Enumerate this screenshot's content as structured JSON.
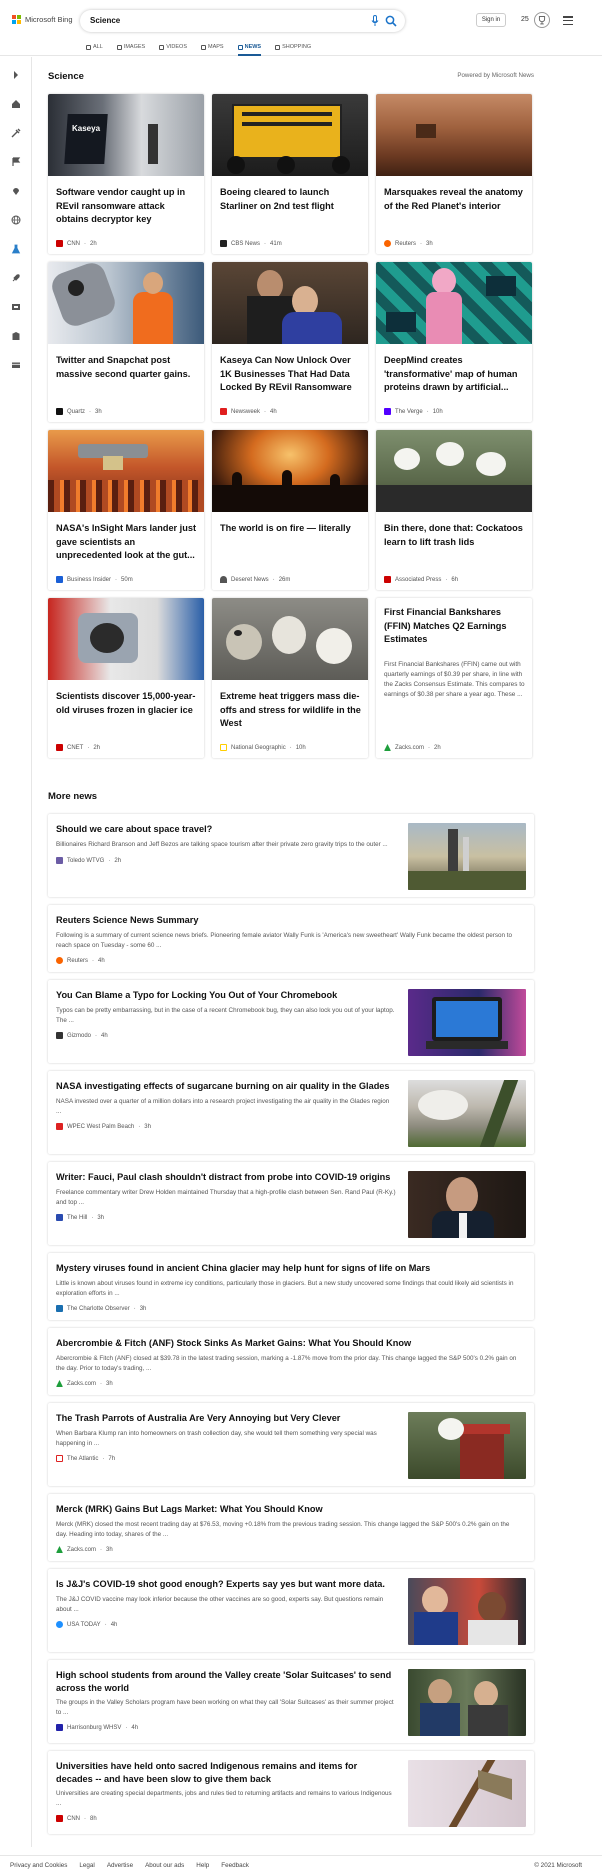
{
  "brand": {
    "name": "Microsoft Bing",
    "colors": [
      "#f25022",
      "#7fba00",
      "#00a4ef",
      "#ffb900"
    ]
  },
  "search": {
    "query": "Science"
  },
  "header": {
    "signin": "Sign in",
    "points": "25"
  },
  "tabs": [
    {
      "label": "ALL",
      "icon": "search-icon"
    },
    {
      "label": "IMAGES",
      "icon": "image-icon"
    },
    {
      "label": "VIDEOS",
      "icon": "video-icon"
    },
    {
      "label": "MAPS",
      "icon": "map-icon"
    },
    {
      "label": "NEWS",
      "icon": "news-icon",
      "active": true
    },
    {
      "label": "SHOPPING",
      "icon": "shopping-icon"
    }
  ],
  "sidebar": [
    "expand-icon",
    "home-icon",
    "tools-icon",
    "flag-icon",
    "location-icon",
    "globe-icon",
    "science-icon",
    "rocket-icon",
    "media-icon",
    "building-icon",
    "card-icon"
  ],
  "section": {
    "title": "Science",
    "powered": "Powered by Microsoft News"
  },
  "cards": [
    {
      "title": "Software vendor caught up in REvil ransomware attack obtains decryptor key",
      "source": "CNN",
      "time": "2h",
      "color": "#cc0000"
    },
    {
      "title": "Boeing cleared to launch Starliner on 2nd test flight",
      "source": "CBS News",
      "time": "41m",
      "color": "#222222"
    },
    {
      "title": "Marsquakes reveal the anatomy of the Red Planet's interior",
      "source": "Reuters",
      "time": "3h",
      "color": "#fa6400"
    },
    {
      "title": "Twitter and Snapchat post massive second quarter gains.",
      "source": "Quartz",
      "time": "3h",
      "color": "#111111"
    },
    {
      "title": "Kaseya Can Now Unlock Over 1K Businesses That Had Data Locked By REvil Ransomware",
      "source": "Newsweek",
      "time": "4h",
      "color": "#e01e1e"
    },
    {
      "title": "DeepMind creates 'transformative' map of human proteins drawn by artificial...",
      "source": "The Verge",
      "time": "10h",
      "color": "#5200ff"
    },
    {
      "title": "NASA's InSight Mars lander just gave scientists an unprecedented look at the gut...",
      "source": "Business Insider",
      "time": "50m",
      "color": "#1a5fd6"
    },
    {
      "title": "The world is on fire — literally",
      "source": "Deseret News",
      "time": "26m",
      "color": "#555555"
    },
    {
      "title": "Bin there, done that: Cockatoos learn to lift trash lids",
      "source": "Associated Press",
      "time": "6h",
      "color": "#cc0000"
    },
    {
      "title": "Scientists discover 15,000-year-old viruses frozen in glacier ice",
      "source": "CNET",
      "time": "2h",
      "color": "#cc0000"
    },
    {
      "title": "Extreme heat triggers mass die-offs and stress for wildlife in the West",
      "source": "National Geographic",
      "time": "10h",
      "color": "#ffce00"
    },
    {
      "title": "First Financial Bankshares (FFIN) Matches Q2 Earnings Estimates",
      "desc": "First Financial Bankshares (FFIN) came out with quarterly earnings of $0.39 per share, in line with the Zacks Consensus Estimate. This compares to earnings of $0.38 per share a year ago. These ...",
      "source": "Zacks.com",
      "time": "2h",
      "color": "#1e9e3c"
    }
  ],
  "more": {
    "title": "More news",
    "items": [
      {
        "title": "Should we care about space travel?",
        "desc": "Billionaires Richard Branson and Jeff Bezos are talking space tourism after their private zero gravity trips to the outer ...",
        "source": "Toledo WTVG",
        "time": "2h",
        "color": "#6b5ca5"
      },
      {
        "title": "Reuters Science News Summary",
        "desc": "Following is a summary of current science news briefs. Pioneering female aviator Wally Funk is 'America's new sweetheart' Wally Funk became the oldest person to reach space on Tuesday - some 60 ...",
        "source": "Reuters",
        "time": "4h",
        "color": "#fa6400"
      },
      {
        "title": "You Can Blame a Typo for Locking You Out of Your Chromebook",
        "desc": "Typos can be pretty embarrassing, but in the case of a recent Chromebook bug, they can also lock you out of your laptop. The ...",
        "source": "Gizmodo",
        "time": "4h",
        "color": "#333333"
      },
      {
        "title": "NASA investigating effects of sugarcane burning on air quality in the Glades",
        "desc": "NASA invested over a quarter of a million dollars into a research project investigating the air quality in the Glades region ...",
        "source": "WPEC West Palm Beach",
        "time": "3h",
        "color": "#d22"
      },
      {
        "title": "Writer: Fauci, Paul clash shouldn't distract from probe into COVID-19 origins",
        "desc": "Freelance commentary writer Drew Holden maintained Thursday that a high-profile clash between Sen. Rand Paul (R-Ky.) and top ...",
        "source": "The Hill",
        "time": "3h",
        "color": "#2a4bb0"
      },
      {
        "title": "Mystery viruses found in ancient China glacier may help hunt for signs of life on Mars",
        "desc": "Little is known about viruses found in extreme icy conditions, particularly those in glaciers. But a new study uncovered some findings that could likely aid scientists in exploration efforts in ...",
        "source": "The Charlotte Observer",
        "time": "3h",
        "color": "#1a6fb0"
      },
      {
        "title": "Abercrombie & Fitch (ANF) Stock Sinks As Market Gains: What You Should Know",
        "desc": "Abercrombie & Fitch (ANF) closed at $39.78 in the latest trading session, marking a -1.87% move from the prior day. This change lagged the S&P 500's 0.2% gain on the day. Prior to today's trading, ...",
        "source": "Zacks.com",
        "time": "3h",
        "color": "#1e9e3c"
      },
      {
        "title": "The Trash Parrots of Australia Are Very Annoying but Very Clever",
        "desc": "When Barbara Klump ran into homeowners on trash collection day, she would tell them something very special was happening in ...",
        "source": "The Atlantic",
        "time": "7h",
        "color": "#d22"
      },
      {
        "title": "Merck (MRK) Gains But Lags Market: What You Should Know",
        "desc": "Merck (MRK) closed the most recent trading day at $76.53, moving +0.18% from the previous trading session. This change lagged the S&P 500's 0.2% gain on the day. Heading into today, shares of the ...",
        "source": "Zacks.com",
        "time": "3h",
        "color": "#1e9e3c"
      },
      {
        "title": "Is J&J's COVID-19 shot good enough? Experts say yes but want more data.",
        "desc": "The J&J COVID vaccine may look inferior because the other vaccines are so good, experts say. But questions remain about ...",
        "source": "USA TODAY",
        "time": "4h",
        "color": "#1e90ff"
      },
      {
        "title": "High school students from around the Valley create 'Solar Suitcases' to send across the world",
        "desc": "The groups in the Valley Scholars program have been working on what they call 'Solar Suitcases' as their summer project to ...",
        "source": "Harrisonburg WHSV",
        "time": "4h",
        "color": "#2222aa"
      },
      {
        "title": "Universities have held onto sacred Indigenous remains and items for decades -- and have been slow to give them back",
        "desc": "Universities are creating special departments, jobs and rules tied to returning artifacts and remains to various Indigenous ...",
        "source": "CNN",
        "time": "8h",
        "color": "#cc0000"
      }
    ]
  },
  "footer": {
    "links": [
      "Privacy and Cookies",
      "Legal",
      "Advertise",
      "About our ads",
      "Help",
      "Feedback"
    ],
    "copyright": "© 2021 Microsoft"
  }
}
